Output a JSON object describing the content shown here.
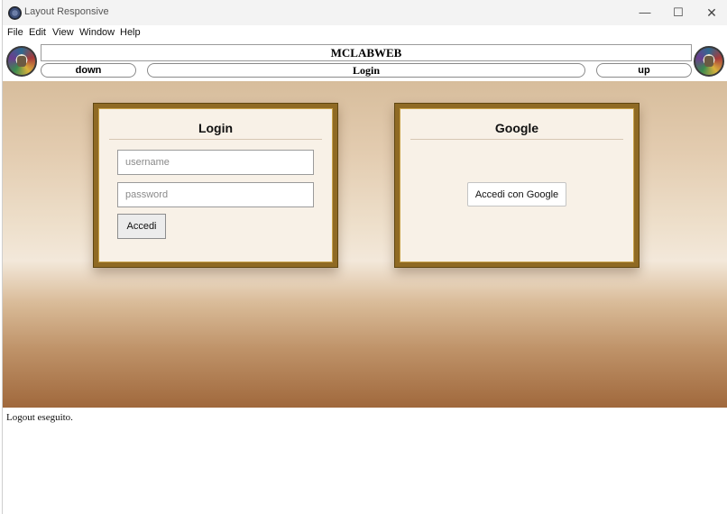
{
  "window": {
    "title": "Layout Responsive",
    "minimize": "—",
    "maximize": "☐",
    "close": "✕"
  },
  "menu": {
    "items": [
      "File",
      "Edit",
      "View",
      "Window",
      "Help"
    ]
  },
  "header": {
    "site_title": "MCLABWEB",
    "down_label": "down",
    "nav_label": "Login",
    "up_label": "up"
  },
  "login_panel": {
    "title": "Login",
    "username_placeholder": "username",
    "password_placeholder": "password",
    "submit_label": "Accedi"
  },
  "google_panel": {
    "title": "Google",
    "button_label": "Accedi con Google"
  },
  "status": {
    "message": "Logout eseguito."
  }
}
